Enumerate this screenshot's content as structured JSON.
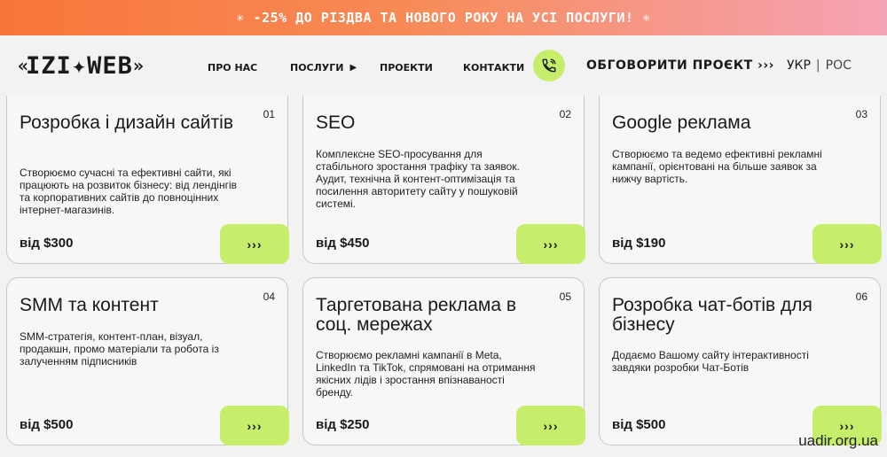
{
  "promo": {
    "text": "-25% ДО РІЗДВА ТА НОВОГО РОКУ НА УСІ ПОСЛУГИ!",
    "star": "✳"
  },
  "logo": {
    "left": "«",
    "text": "IZI✦WEB",
    "right": "»"
  },
  "nav": [
    {
      "label": "ПРО НАС"
    },
    {
      "label": "ПОСЛУГИ",
      "has_dropdown": true
    },
    {
      "label": "ПРОЕКТИ"
    },
    {
      "label": "КОНТАКТИ"
    }
  ],
  "cta": {
    "label": "ОБГОВОРИТИ ПРОЄКТ ›››"
  },
  "lang": {
    "active": "УКР",
    "separator": "|",
    "other": "РОС"
  },
  "colors": {
    "accent": "#c6ee6a",
    "promo_start": "#f8763a",
    "promo_end": "#f5a3b6"
  },
  "services": [
    {
      "num": "01",
      "title": "Розробка  і дизайн сайтів",
      "desc": "Створюємо сучасні та ефективні сайти, які працюють на розвиток бізнесу: від лендінгів та корпоративних сайтів до повноцінних інтернет-магазинів.",
      "price": "від $300",
      "button": "›››"
    },
    {
      "num": "02",
      "title": "SEO",
      "desc": "Комплексне SEO-просування для стабільного зростання трафіку та заявок. Аудит, технічна й контент-оптимізація та посилення авторитету сайту у пошуковій системі.",
      "price": "від $450",
      "button": "›››"
    },
    {
      "num": "03",
      "title": "Google реклама",
      "desc": "Створюємо та ведемо ефективні рекламні кампанії, орієнтовані на більше заявок за нижчу вартість.",
      "price": "від $190",
      "button": "›››"
    },
    {
      "num": "04",
      "title": "SMM  та контент",
      "desc": "SMM-стратегія, контент-план, візуал, продакшн, промо матеріали та робота  із залученням підписників",
      "price": "від $500",
      "button": "›››"
    },
    {
      "num": "05",
      "title": "Таргетована реклама  в соц. мережах",
      "desc": "Створюємо рекламні кампанії в Meta, LinkedIn та TikTok, спрямовані на отримання якісних лідів і зростання впізнаваності бренду.",
      "price": "від $250",
      "button": "›››"
    },
    {
      "num": "06",
      "title": "Розробка чат-ботів для бізнесу",
      "desc": "Додаємо Вашому сайту інтерактивності завдяки розробки Чат-Ботів",
      "price": "від $500",
      "button": "›››"
    }
  ],
  "watermark": "uadir.org.ua"
}
